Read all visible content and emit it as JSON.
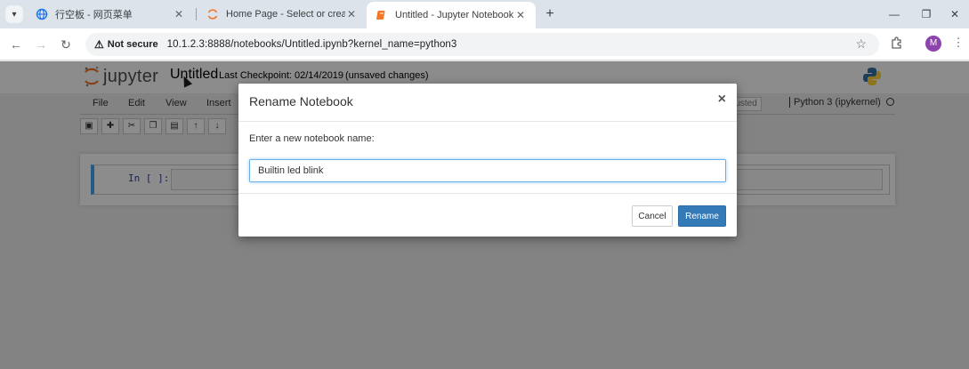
{
  "browser": {
    "tabs": [
      {
        "title": "行空板 - 网页菜单",
        "icon": "globe-icon"
      },
      {
        "title": "Home Page - Select or create a",
        "icon": "jupyter-spinner-icon"
      },
      {
        "title": "Untitled - Jupyter Notebook",
        "icon": "notebook-icon",
        "active": true
      }
    ],
    "security_label": "Not secure",
    "url": "10.1.2.3:8888/notebooks/Untitled.ipynb?kernel_name=python3",
    "profile_initial": "M"
  },
  "jupyter": {
    "logo_text": "jupyter",
    "notebook_name": "Untitled",
    "checkpoint": "Last Checkpoint: 02/14/2019",
    "unsaved": "(unsaved changes)",
    "menu": [
      "File",
      "Edit",
      "View",
      "Insert"
    ],
    "trusted_label": "rusted",
    "kernel_label": "Python 3 (ipykernel)",
    "cell_prompt": "In [ ]:"
  },
  "dialog": {
    "title": "Rename Notebook",
    "close_label": "×",
    "label": "Enter a new notebook name:",
    "input_value": "Builtin led blink",
    "cancel_label": "Cancel",
    "rename_label": "Rename"
  },
  "colors": {
    "primary_button": "#337ab7",
    "cell_selected_border": "#42a5f5",
    "jupyter_orange": "#f37726"
  }
}
